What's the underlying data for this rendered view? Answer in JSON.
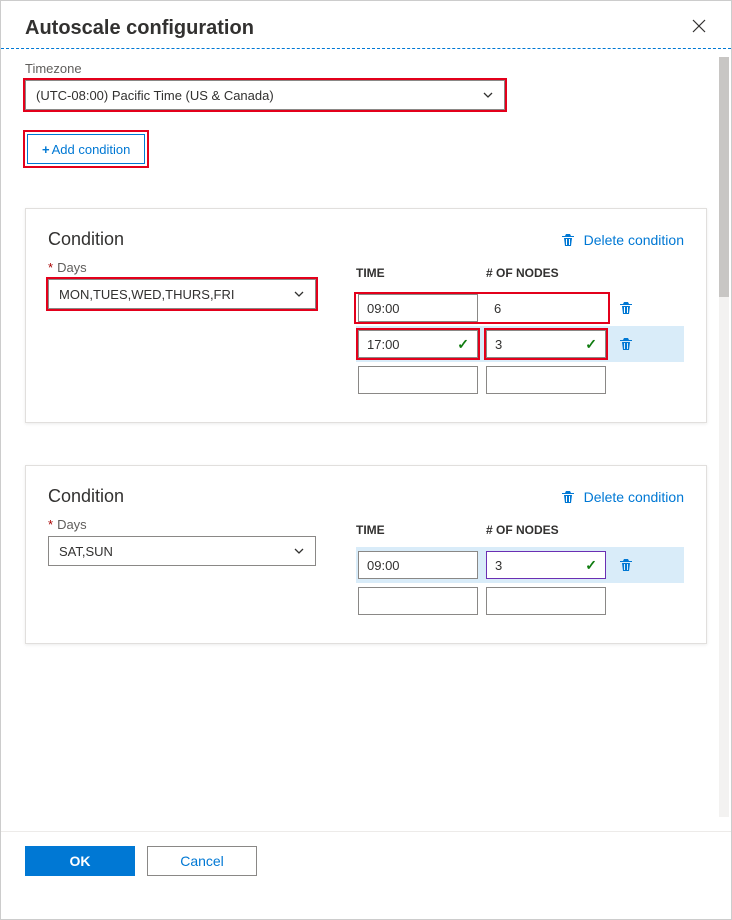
{
  "header": {
    "title": "Autoscale configuration"
  },
  "timezone": {
    "label": "Timezone",
    "value": "(UTC-08:00) Pacific Time (US & Canada)"
  },
  "add_condition_label": "Add condition",
  "table_headers": {
    "time": "TIME",
    "nodes": "# OF NODES"
  },
  "delete_condition_label": "Delete condition",
  "condition_title": "Condition",
  "days_label": "Days",
  "conditions": [
    {
      "days": "MON,TUES,WED,THURS,FRI",
      "rows": [
        {
          "time": "09:00",
          "nodes": "6",
          "selected": false,
          "validated": false
        },
        {
          "time": "17:00",
          "nodes": "3",
          "selected": true,
          "validated": true
        },
        {
          "time": "",
          "nodes": "",
          "selected": false,
          "validated": false
        }
      ]
    },
    {
      "days": "SAT,SUN",
      "rows": [
        {
          "time": "09:00",
          "nodes": "3",
          "selected": true,
          "validated": true,
          "purple": true
        },
        {
          "time": "",
          "nodes": "",
          "selected": false,
          "validated": false
        }
      ]
    }
  ],
  "footer": {
    "ok": "OK",
    "cancel": "Cancel"
  }
}
